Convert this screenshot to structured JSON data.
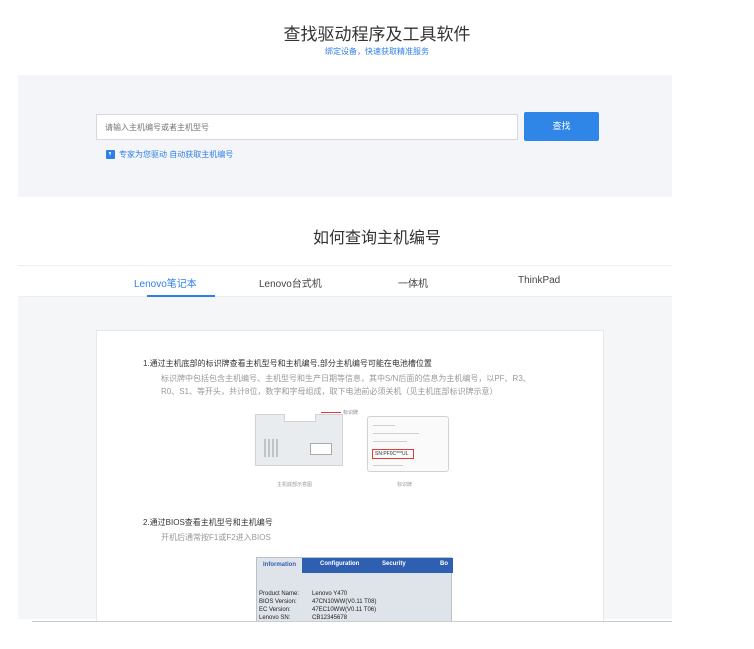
{
  "header": {
    "title": "查找驱动程序及工具软件",
    "subtitle": "绑定设备，快速获取精准服务"
  },
  "search": {
    "placeholder": "请输入主机编号或者主机型号",
    "button_label": "查找",
    "expert_link": "专家为您驱动 自动获取主机编号"
  },
  "howto": {
    "title": "如何查询主机编号",
    "tabs": [
      {
        "label": "Lenovo笔记本",
        "active": true
      },
      {
        "label": "Lenovo台式机",
        "active": false
      },
      {
        "label": "一体机",
        "active": false
      },
      {
        "label": "ThinkPad",
        "active": false
      }
    ]
  },
  "steps": {
    "step1_title": "1.通过主机底部的标识牌查看主机型号和主机编号,部分主机编号可能在电池槽位置",
    "step1_desc_line1": "标识牌中包括包含主机编号、主机型号和生产日期等信息，其中S/N后面的信息为主机编号，以PF、R3、",
    "step1_desc_line2": "R0、S1、等开头，共计8位，数字和字母组成，取下电池前必须关机（见主机底部标识牌示意）",
    "sticker_label": "标识牌",
    "laptop_caption": "主机底部示意图",
    "label_caption": "标识牌",
    "sn_text": "SN:PF0C***UL",
    "step2_title": "2.通过BIOS查看主机型号和主机编号",
    "step2_desc": "开机后通常按F1或F2进入BIOS"
  },
  "bios": {
    "tabs": [
      "Information",
      "Configuration",
      "Security",
      "Bo"
    ],
    "rows": [
      {
        "label": "Product Name:",
        "value": "Lenovo Y470"
      },
      {
        "label": "BIOS Version:",
        "value": "47CN10WW(V0.11 T08)"
      },
      {
        "label": "EC Version:",
        "value": "47EC10WW(V0.11 T06)"
      },
      {
        "label": "Lenovo SN:",
        "value": "CB12345678"
      }
    ]
  },
  "colors": {
    "accent": "#2f7fe8",
    "button": "#2f86e6",
    "highlight_red": "#e03a3a",
    "bios_blue": "#2f5fb0"
  }
}
